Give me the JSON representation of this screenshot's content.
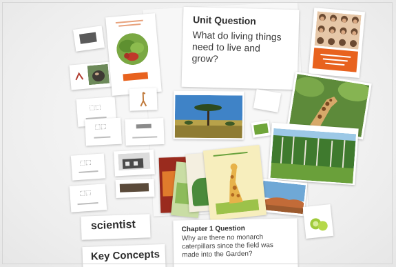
{
  "unit_card": {
    "heading": "Unit Question",
    "question": "What do living things need to live and grow?"
  },
  "words": {
    "scientist": "scientist",
    "key_concepts": "Key Concepts"
  },
  "chapter_card": {
    "heading": "Chapter 1 Question",
    "question": "Why are there no monarch caterpillars since the field was made into the Garden?"
  },
  "colors": {
    "accent_orange": "#e8621e",
    "card_white": "#ffffff",
    "background": "#efefef"
  }
}
